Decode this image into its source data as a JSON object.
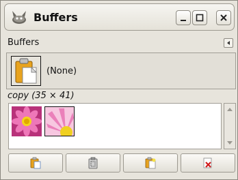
{
  "window": {
    "title": "Buffers"
  },
  "panel": {
    "title": "Buffers"
  },
  "current_buffer": {
    "label": "(None)"
  },
  "selection": {
    "label": "copy (35 × 41)"
  },
  "buffers": [
    {
      "icon": "pink-flower-thumbnail"
    },
    {
      "icon": "pink-flower-closeup-thumbnail"
    }
  ],
  "toolbar": {
    "buttons": [
      {
        "icon": "paste-icon"
      },
      {
        "icon": "paste-into-icon"
      },
      {
        "icon": "paste-as-new-icon"
      },
      {
        "icon": "delete-buffer-icon"
      }
    ]
  },
  "colors": {
    "accent_red": "#d11b1b",
    "window_bg": "#e7e4dc"
  }
}
